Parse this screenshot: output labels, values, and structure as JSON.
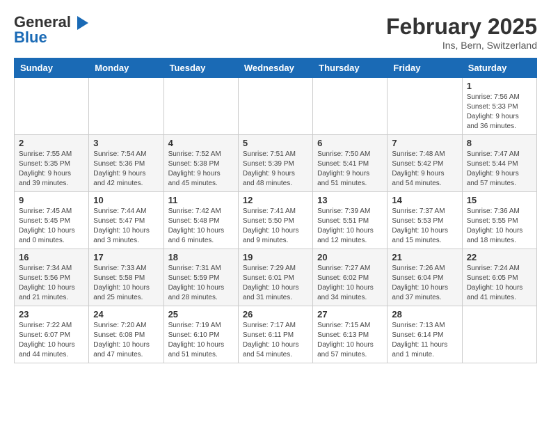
{
  "header": {
    "logo_line1": "General",
    "logo_line2": "Blue",
    "title": "February 2025",
    "subtitle": "Ins, Bern, Switzerland"
  },
  "weekdays": [
    "Sunday",
    "Monday",
    "Tuesday",
    "Wednesday",
    "Thursday",
    "Friday",
    "Saturday"
  ],
  "weeks": [
    [
      {
        "day": "",
        "info": ""
      },
      {
        "day": "",
        "info": ""
      },
      {
        "day": "",
        "info": ""
      },
      {
        "day": "",
        "info": ""
      },
      {
        "day": "",
        "info": ""
      },
      {
        "day": "",
        "info": ""
      },
      {
        "day": "1",
        "info": "Sunrise: 7:56 AM\nSunset: 5:33 PM\nDaylight: 9 hours and 36 minutes."
      }
    ],
    [
      {
        "day": "2",
        "info": "Sunrise: 7:55 AM\nSunset: 5:35 PM\nDaylight: 9 hours and 39 minutes."
      },
      {
        "day": "3",
        "info": "Sunrise: 7:54 AM\nSunset: 5:36 PM\nDaylight: 9 hours and 42 minutes."
      },
      {
        "day": "4",
        "info": "Sunrise: 7:52 AM\nSunset: 5:38 PM\nDaylight: 9 hours and 45 minutes."
      },
      {
        "day": "5",
        "info": "Sunrise: 7:51 AM\nSunset: 5:39 PM\nDaylight: 9 hours and 48 minutes."
      },
      {
        "day": "6",
        "info": "Sunrise: 7:50 AM\nSunset: 5:41 PM\nDaylight: 9 hours and 51 minutes."
      },
      {
        "day": "7",
        "info": "Sunrise: 7:48 AM\nSunset: 5:42 PM\nDaylight: 9 hours and 54 minutes."
      },
      {
        "day": "8",
        "info": "Sunrise: 7:47 AM\nSunset: 5:44 PM\nDaylight: 9 hours and 57 minutes."
      }
    ],
    [
      {
        "day": "9",
        "info": "Sunrise: 7:45 AM\nSunset: 5:45 PM\nDaylight: 10 hours and 0 minutes."
      },
      {
        "day": "10",
        "info": "Sunrise: 7:44 AM\nSunset: 5:47 PM\nDaylight: 10 hours and 3 minutes."
      },
      {
        "day": "11",
        "info": "Sunrise: 7:42 AM\nSunset: 5:48 PM\nDaylight: 10 hours and 6 minutes."
      },
      {
        "day": "12",
        "info": "Sunrise: 7:41 AM\nSunset: 5:50 PM\nDaylight: 10 hours and 9 minutes."
      },
      {
        "day": "13",
        "info": "Sunrise: 7:39 AM\nSunset: 5:51 PM\nDaylight: 10 hours and 12 minutes."
      },
      {
        "day": "14",
        "info": "Sunrise: 7:37 AM\nSunset: 5:53 PM\nDaylight: 10 hours and 15 minutes."
      },
      {
        "day": "15",
        "info": "Sunrise: 7:36 AM\nSunset: 5:55 PM\nDaylight: 10 hours and 18 minutes."
      }
    ],
    [
      {
        "day": "16",
        "info": "Sunrise: 7:34 AM\nSunset: 5:56 PM\nDaylight: 10 hours and 21 minutes."
      },
      {
        "day": "17",
        "info": "Sunrise: 7:33 AM\nSunset: 5:58 PM\nDaylight: 10 hours and 25 minutes."
      },
      {
        "day": "18",
        "info": "Sunrise: 7:31 AM\nSunset: 5:59 PM\nDaylight: 10 hours and 28 minutes."
      },
      {
        "day": "19",
        "info": "Sunrise: 7:29 AM\nSunset: 6:01 PM\nDaylight: 10 hours and 31 minutes."
      },
      {
        "day": "20",
        "info": "Sunrise: 7:27 AM\nSunset: 6:02 PM\nDaylight: 10 hours and 34 minutes."
      },
      {
        "day": "21",
        "info": "Sunrise: 7:26 AM\nSunset: 6:04 PM\nDaylight: 10 hours and 37 minutes."
      },
      {
        "day": "22",
        "info": "Sunrise: 7:24 AM\nSunset: 6:05 PM\nDaylight: 10 hours and 41 minutes."
      }
    ],
    [
      {
        "day": "23",
        "info": "Sunrise: 7:22 AM\nSunset: 6:07 PM\nDaylight: 10 hours and 44 minutes."
      },
      {
        "day": "24",
        "info": "Sunrise: 7:20 AM\nSunset: 6:08 PM\nDaylight: 10 hours and 47 minutes."
      },
      {
        "day": "25",
        "info": "Sunrise: 7:19 AM\nSunset: 6:10 PM\nDaylight: 10 hours and 51 minutes."
      },
      {
        "day": "26",
        "info": "Sunrise: 7:17 AM\nSunset: 6:11 PM\nDaylight: 10 hours and 54 minutes."
      },
      {
        "day": "27",
        "info": "Sunrise: 7:15 AM\nSunset: 6:13 PM\nDaylight: 10 hours and 57 minutes."
      },
      {
        "day": "28",
        "info": "Sunrise: 7:13 AM\nSunset: 6:14 PM\nDaylight: 11 hours and 1 minute."
      },
      {
        "day": "",
        "info": ""
      }
    ]
  ]
}
